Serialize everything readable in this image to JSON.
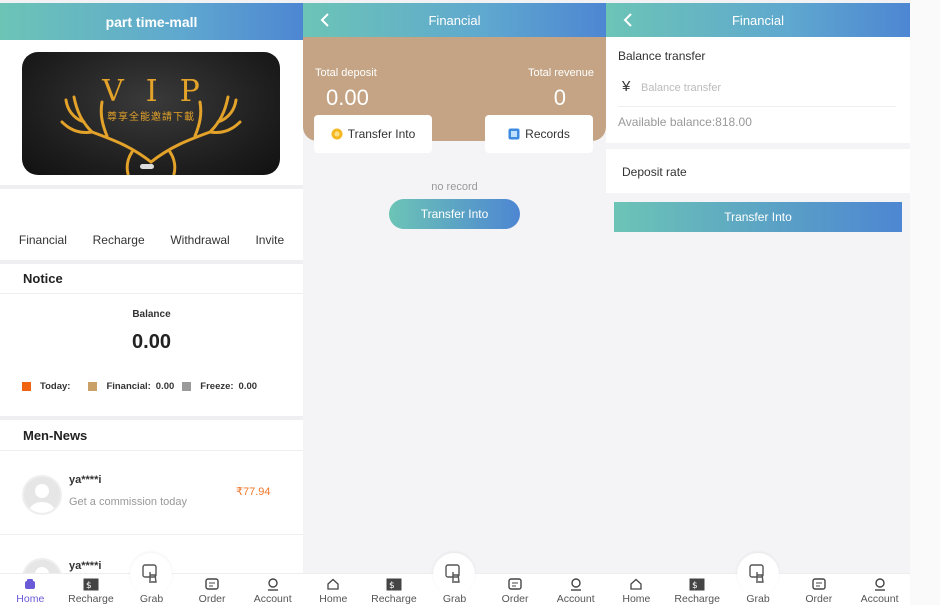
{
  "home": {
    "title": "part time-mall",
    "banner": {
      "big": "VIP",
      "small": "尊享全能邀請下載"
    },
    "quick_links": [
      "Financial",
      "Recharge",
      "Withdrawal",
      "Invite"
    ],
    "notice_title": "Notice",
    "balance_label": "Balance",
    "balance_value": "0.00",
    "legend": {
      "today_label": "Today:",
      "financial_label": "Financial:",
      "financial_value": "0.00",
      "freeze_label": "Freeze:",
      "freeze_value": "0.00",
      "colors": {
        "today": "#f06313",
        "financial": "#c8a068",
        "freeze": "#9a9a9a"
      }
    },
    "news_title": "Men-News",
    "news": [
      {
        "name": "ya****i",
        "desc": "Get a commission today",
        "amount": "₹77.94"
      },
      {
        "name": "ya****i",
        "desc": "",
        "amount": ""
      }
    ]
  },
  "financial": {
    "title": "Financial",
    "total_deposit_label": "Total deposit",
    "total_deposit_value": "0.00",
    "total_revenue_label": "Total revenue",
    "total_revenue_value": "0",
    "transfer_into_label": "Transfer Into",
    "records_label": "Records",
    "empty_text": "no record",
    "pill_button_label": "Transfer Into"
  },
  "transfer": {
    "title": "Financial",
    "section_label": "Balance transfer",
    "currency_symbol": "¥",
    "input_placeholder": "Balance transfer",
    "available_balance": "Available balance:818.00",
    "deposit_rate_label": "Deposit rate",
    "submit_label": "Transfer Into"
  },
  "tabbar": [
    "Home",
    "Recharge",
    "Grab",
    "Order",
    "Account"
  ],
  "colors": {
    "header_start": "#6cc4b6",
    "header_end": "#4d86d2",
    "card": "#c4a484",
    "accent_amount": "#f0762a",
    "active_tab": "#6a5ad8"
  }
}
